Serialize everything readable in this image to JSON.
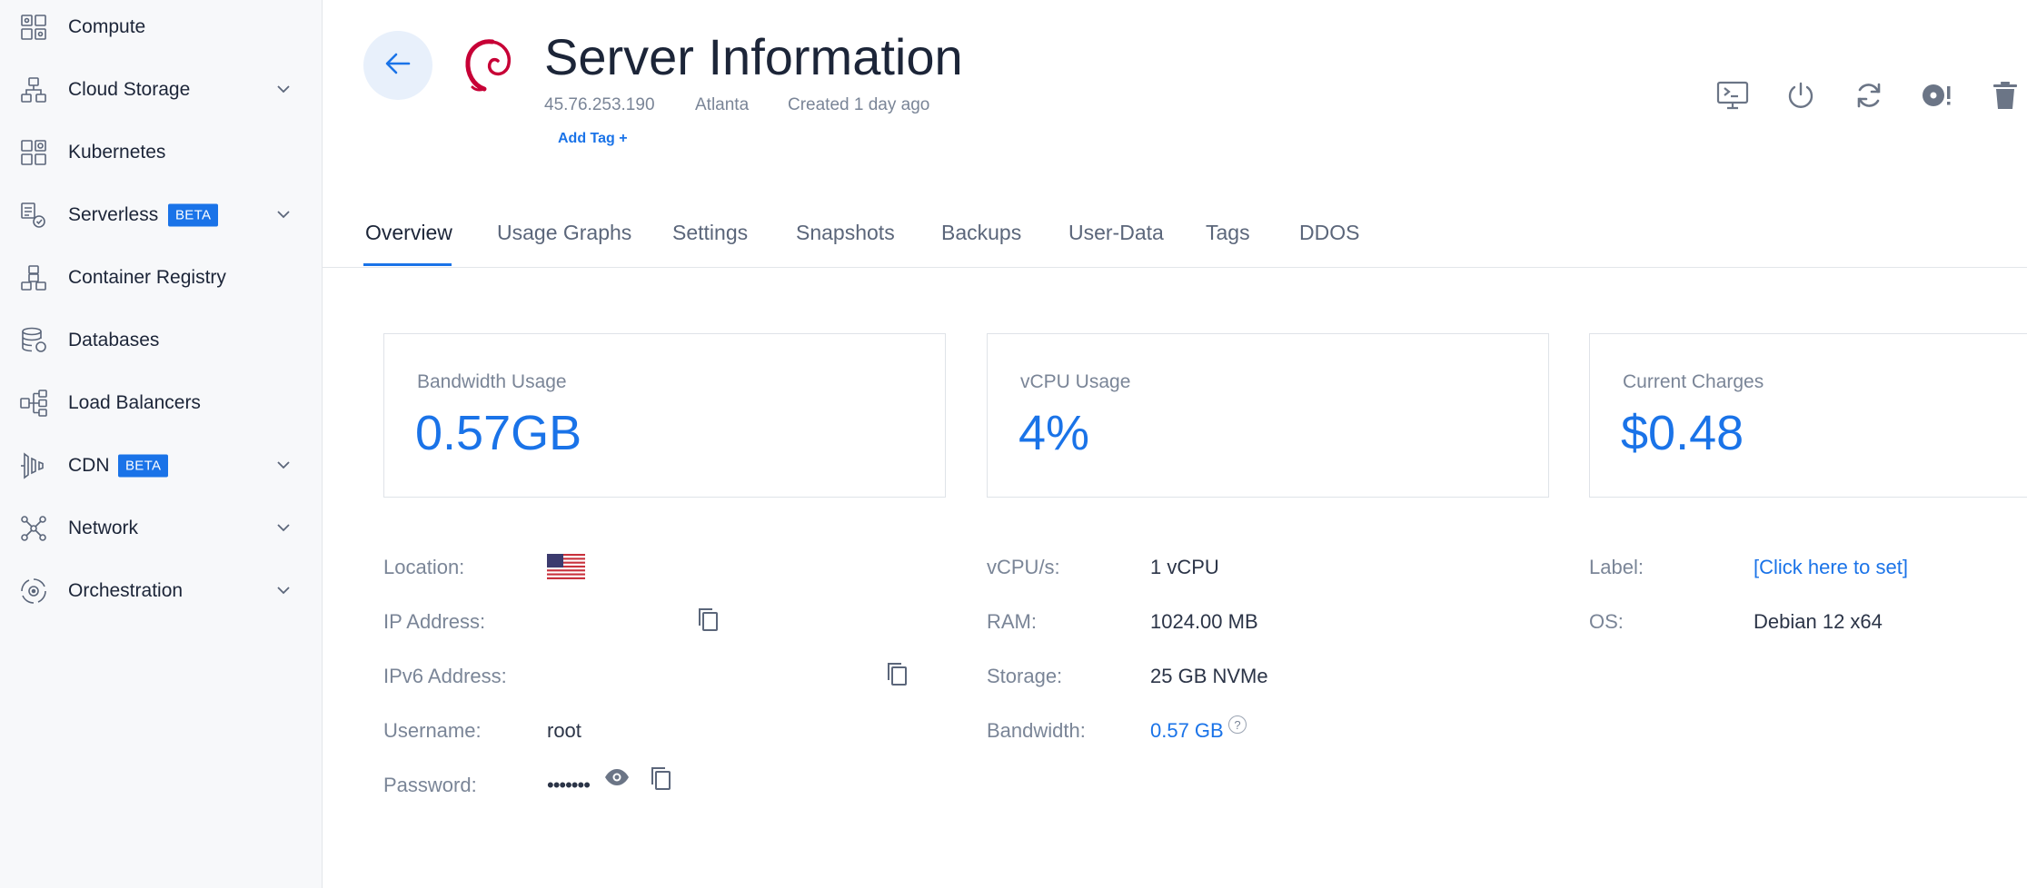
{
  "sidebar": {
    "items": [
      {
        "label": "Compute",
        "icon": "compute-icon"
      },
      {
        "label": "Cloud Storage",
        "icon": "cloud-storage-icon",
        "expandable": true
      },
      {
        "label": "Kubernetes",
        "icon": "kubernetes-icon"
      },
      {
        "label": "Serverless",
        "icon": "serverless-icon",
        "badge": "BETA",
        "expandable": true
      },
      {
        "label": "Container Registry",
        "icon": "container-registry-icon"
      },
      {
        "label": "Databases",
        "icon": "database-icon"
      },
      {
        "label": "Load Balancers",
        "icon": "load-balancer-icon"
      },
      {
        "label": "CDN",
        "icon": "cdn-icon",
        "badge": "BETA",
        "expandable": true
      },
      {
        "label": "Network",
        "icon": "network-icon",
        "expandable": true
      },
      {
        "label": "Orchestration",
        "icon": "orchestration-icon",
        "expandable": true
      }
    ]
  },
  "header": {
    "title": "Server Information",
    "ip": "45.76.253.190",
    "location": "Atlanta",
    "created": "Created 1 day ago",
    "add_tag": "Add Tag +",
    "os_icon": "debian-logo",
    "toolbar": [
      "console-icon",
      "power-icon",
      "restart-icon",
      "reinstall-icon",
      "trash-icon"
    ]
  },
  "tabs": [
    "Overview",
    "Usage Graphs",
    "Settings",
    "Snapshots",
    "Backups",
    "User-Data",
    "Tags",
    "DDOS"
  ],
  "active_tab": "Overview",
  "cards": [
    {
      "title": "Bandwidth Usage",
      "value": "0.57GB"
    },
    {
      "title": "vCPU Usage",
      "value": "4%"
    },
    {
      "title": "Current Charges",
      "value": "$0.48"
    }
  ],
  "details": {
    "location_label": "Location:",
    "ip_label": "IP Address:",
    "ipv6_label": "IPv6 Address:",
    "username_label": "Username:",
    "username": "root",
    "password_label": "Password:",
    "password": "•••••••",
    "vcpu_label": "vCPU/s:",
    "vcpu": "1 vCPU",
    "ram_label": "RAM:",
    "ram": "1024.00 MB",
    "storage_label": "Storage:",
    "storage": "25 GB NVMe",
    "bandwidth_label": "Bandwidth:",
    "bandwidth": "0.57 GB",
    "help": "?",
    "label_label": "Label:",
    "label_value": "[Click here to set]",
    "os_label": "OS:",
    "os": "Debian 12 x64"
  },
  "colors": {
    "accent": "#1a73e8",
    "debian": "#c70036",
    "sidebar_bg": "#f7f8fa"
  }
}
